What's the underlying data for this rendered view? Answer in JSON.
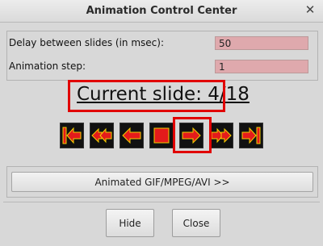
{
  "window": {
    "title": "Animation Control Center",
    "close_glyph": "✕"
  },
  "params": {
    "delay_label": "Delay between slides (in msec):",
    "delay_value": "50",
    "step_label": "Animation step:",
    "step_value": "1"
  },
  "status": {
    "current_slide": "Current slide: 4/18"
  },
  "controls": [
    {
      "name": "first-slide-icon"
    },
    {
      "name": "rewind-icon"
    },
    {
      "name": "step-back-icon"
    },
    {
      "name": "stop-icon"
    },
    {
      "name": "step-forward-icon"
    },
    {
      "name": "fast-forward-icon"
    },
    {
      "name": "last-slide-icon"
    }
  ],
  "colors": {
    "control_bg": "#111111",
    "arrow_fill": "#e41b1b",
    "arrow_stroke": "#f0d000",
    "highlight": "#e10000",
    "input_bg": "#dfa9ad"
  },
  "buttons": {
    "animated_gif": "Animated GIF/MPEG/AVI >>",
    "hide": "Hide",
    "close": "Close"
  }
}
